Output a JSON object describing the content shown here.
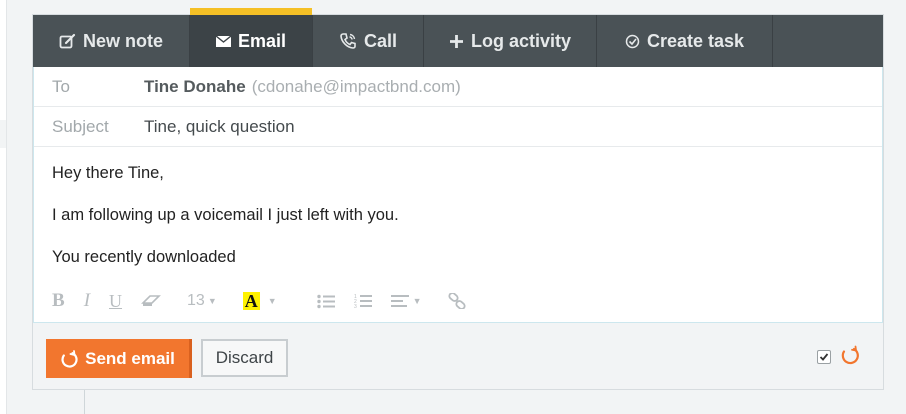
{
  "tabs": [
    {
      "label": "New note",
      "icon": "note-edit-icon"
    },
    {
      "label": "Email",
      "icon": "envelope-icon",
      "active": true
    },
    {
      "label": "Call",
      "icon": "phone-icon"
    },
    {
      "label": "Log activity",
      "icon": "plus-icon"
    },
    {
      "label": "Create task",
      "icon": "check-circle-icon"
    }
  ],
  "email": {
    "to_label": "To",
    "recipient_name": "Tine Donahe",
    "recipient_email": "(cdonahe@impactbnd.com)",
    "subject_label": "Subject",
    "subject_value": "Tine, quick question",
    "body_lines": [
      "Hey there Tine,",
      "I am following up a voicemail I just left with you.",
      "You recently downloaded"
    ]
  },
  "toolbar": {
    "bold": "B",
    "italic": "I",
    "underline": "U",
    "font_size": "13",
    "text_color_letter": "A",
    "items": [
      "bold-icon",
      "italic-icon",
      "underline-icon",
      "eraser-icon",
      "font-size-select",
      "text-color-icon",
      "bulleted-list-icon",
      "numbered-list-icon",
      "align-icon",
      "link-icon"
    ]
  },
  "actions": {
    "send_label": "Send email",
    "discard_label": "Discard",
    "track_checked": true
  },
  "colors": {
    "tab_bar": "#4a5256",
    "active_tab_accent": "#f5c026",
    "send_button": "#f2762e",
    "highlight": "#fff200"
  }
}
